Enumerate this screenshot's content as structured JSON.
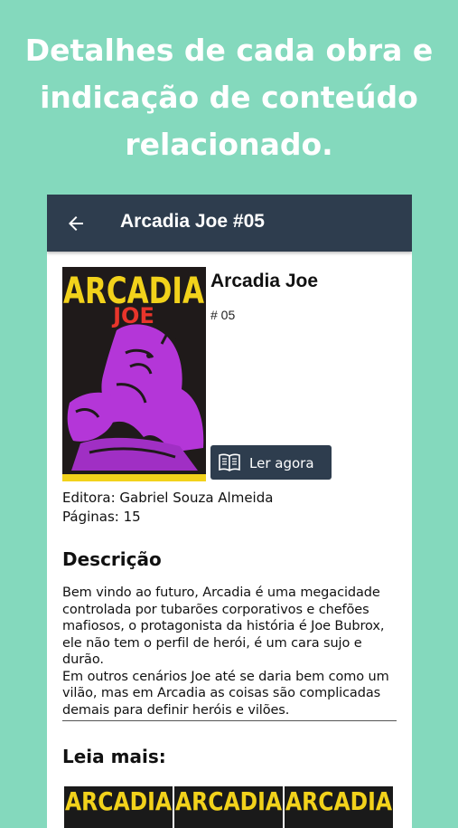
{
  "promo": {
    "headline_line1": "Detalhes de cada obra e",
    "headline_line2": "indicação de conteúdo",
    "headline_line3": "relacionado."
  },
  "appbar": {
    "title": "Arcadia Joe #05",
    "back_icon": "arrow-left-icon"
  },
  "comic": {
    "cover_title": "ARCADIA",
    "cover_subtitle": "JOE",
    "title": "Arcadia Joe",
    "issue": "# 05",
    "read_button_label": "Ler agora",
    "read_button_icon": "open-book-icon",
    "publisher": "Editora: Gabriel Souza Almeida",
    "pages": "Páginas: 15"
  },
  "description": {
    "heading": "Descrição",
    "lines": [
      "Bem vindo ao futuro, Arcadia é uma megacidade",
      "controlada por tubarões corporativos e chefões",
      "mafiosos, o protagonista da história é Joe Bubrox,",
      "ele não tem o perfil de herói, é um cara sujo e durão.",
      "Em outros cenários Joe até se daria bem como um",
      "vilão, mas em Arcadia as coisas são complicadas",
      "demais para definir heróis e vilões."
    ]
  },
  "related": {
    "heading": "Leia mais:",
    "items": [
      {
        "title": "ARCADIA"
      },
      {
        "title": "ARCADIA"
      },
      {
        "title": "ARCADIA"
      }
    ]
  },
  "colors": {
    "background": "#84d9bd",
    "appbar": "#2e3d4e",
    "cover_yellow": "#f2d21b",
    "cover_magenta": "#b436d8",
    "cover_red": "#e8352b"
  }
}
